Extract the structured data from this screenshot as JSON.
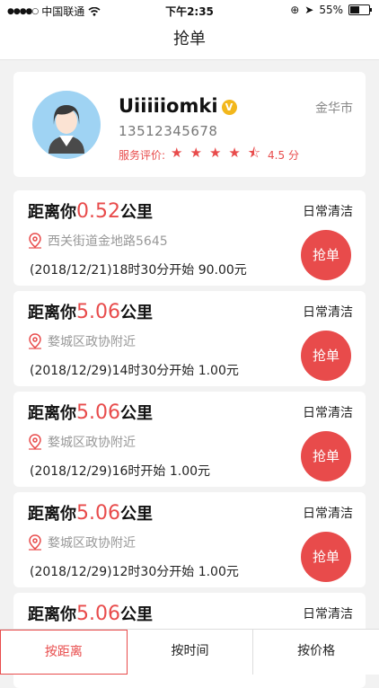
{
  "status": {
    "carrier": "中国联通",
    "time": "下午2:35",
    "battery": "55%"
  },
  "nav": {
    "title": "抢单"
  },
  "profile": {
    "name": "Uiiiiiomki",
    "badge": "V",
    "phone": "13512345678",
    "rating_label": "服务评价:",
    "rating_value": "4.5 分",
    "stars": "★★★★⯪",
    "city": "金华市"
  },
  "orders": [
    {
      "prefix": "距离你",
      "distance": "0.52",
      "unit": "公里",
      "type": "日常清洁",
      "address": "西关街道金地路5645",
      "time": "(2018/12/21)18时30分开始  90.00元",
      "button": "抢单"
    },
    {
      "prefix": "距离你",
      "distance": "5.06",
      "unit": "公里",
      "type": "日常清洁",
      "address": "婺城区政协附近",
      "time": "(2018/12/29)14时30分开始  1.00元",
      "button": "抢单"
    },
    {
      "prefix": "距离你",
      "distance": "5.06",
      "unit": "公里",
      "type": "日常清洁",
      "address": "婺城区政协附近",
      "time": "(2018/12/29)16时开始  1.00元",
      "button": "抢单"
    },
    {
      "prefix": "距离你",
      "distance": "5.06",
      "unit": "公里",
      "type": "日常清洁",
      "address": "婺城区政协附近",
      "time": "(2018/12/29)12时30分开始  1.00元",
      "button": "抢单"
    },
    {
      "prefix": "距离你",
      "distance": "5.06",
      "unit": "公里",
      "type": "日常清洁"
    }
  ],
  "tabs": [
    "按距离",
    "按时间",
    "按价格"
  ],
  "colors": {
    "accent": "#e84b4b"
  }
}
